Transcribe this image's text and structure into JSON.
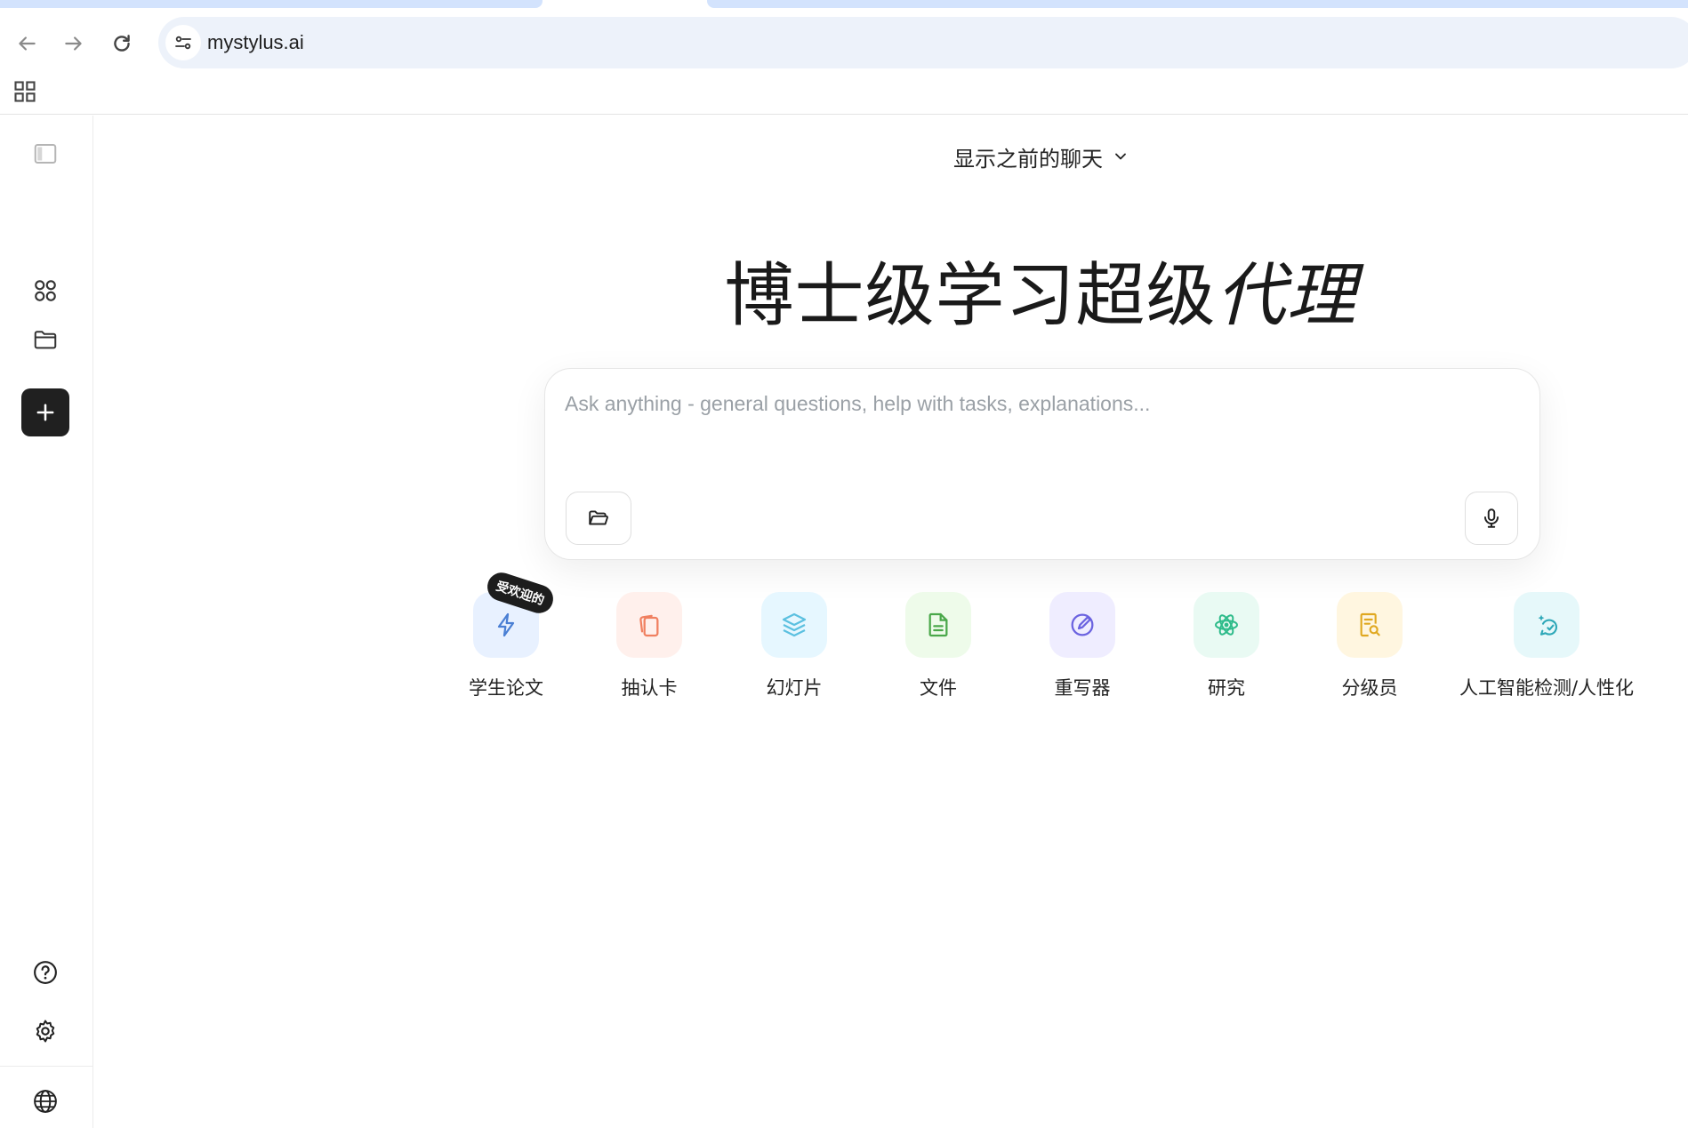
{
  "browser": {
    "url": "mystylus.ai",
    "icons": {
      "back": "arrow-left-icon",
      "forward": "arrow-right-icon",
      "reload": "reload-icon",
      "site_info": "tune-icon",
      "apps": "apps-grid-icon"
    }
  },
  "sidebar": {
    "icons": [
      "sidebar-toggle-icon",
      "apps-circles-icon",
      "folder-icon",
      "plus-icon",
      "help-icon",
      "gear-icon",
      "globe-icon"
    ]
  },
  "main": {
    "previous_chats_label": "显示之前的聊天",
    "hero_title_regular": "博士级学习超级",
    "hero_title_italic": "代理",
    "composer": {
      "placeholder": "Ask anything - general questions, help with tasks, explanations..."
    },
    "popular_badge": "受欢迎的",
    "tools": [
      {
        "label": "学生论文",
        "icon": "lightning-icon",
        "bg": "#e8f1ff",
        "color": "#4a7fd4"
      },
      {
        "label": "抽认卡",
        "icon": "cards-icon",
        "bg": "#fff0ec",
        "color": "#f08060"
      },
      {
        "label": "幻灯片",
        "icon": "layers-icon",
        "bg": "#e6f7ff",
        "color": "#5bc0e0"
      },
      {
        "label": "文件",
        "icon": "document-icon",
        "bg": "#eefbea",
        "color": "#4aa84a"
      },
      {
        "label": "重写器",
        "icon": "rewrite-icon",
        "bg": "#efedff",
        "color": "#6b63e0"
      },
      {
        "label": "研究",
        "icon": "atom-icon",
        "bg": "#e9faf3",
        "color": "#2dbb8a"
      },
      {
        "label": "分级员",
        "icon": "grade-doc-icon",
        "bg": "#fff6e0",
        "color": "#e0a820"
      },
      {
        "label": "人工智能检测/人性化",
        "icon": "ai-detect-icon",
        "bg": "#e6f8fa",
        "color": "#2ea8b8"
      }
    ]
  }
}
